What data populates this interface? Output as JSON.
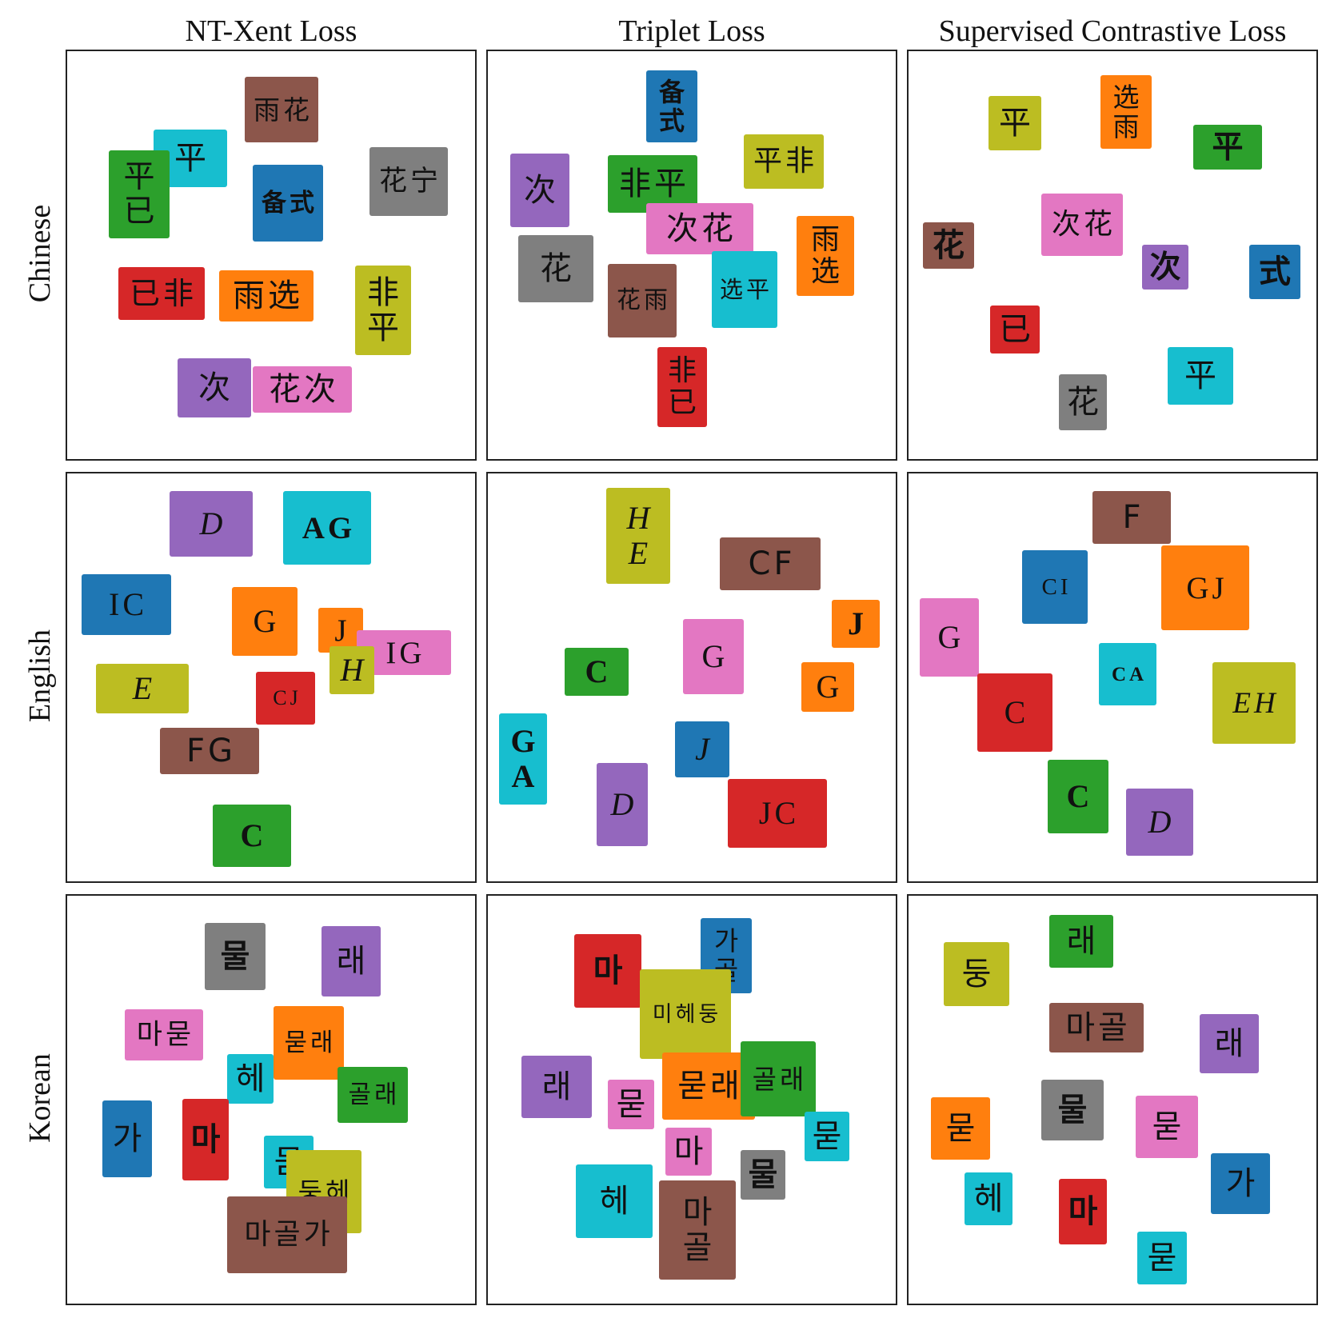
{
  "colors": {
    "blue": "#1f77b4",
    "orange": "#ff7f0e",
    "green": "#2ca02c",
    "red": "#d62728",
    "purple": "#9467bd",
    "brown": "#8c564b",
    "pink": "#e377c2",
    "gray": "#7f7f7f",
    "olive": "#bcbd22",
    "cyan": "#17becf"
  },
  "columns": [
    "NT-Xent Loss",
    "Triplet Loss",
    "Supervised Contrastive Loss"
  ],
  "rows": [
    "Chinese",
    "English",
    "Korean"
  ],
  "panels": [
    [
      {
        "blobs": [
          {
            "c": "brown",
            "g": [
              "雨",
              "花"
            ]
          },
          {
            "c": "cyan",
            "g": [
              "平"
            ]
          },
          {
            "c": "green",
            "g": [
              "平",
              "已"
            ]
          },
          {
            "c": "blue",
            "g": [
              "备",
              "式"
            ],
            "s": "bold"
          },
          {
            "c": "gray",
            "g": [
              "花",
              "宁"
            ]
          },
          {
            "c": "red",
            "g": [
              "已",
              "非"
            ]
          },
          {
            "c": "orange",
            "g": [
              "雨",
              "选"
            ]
          },
          {
            "c": "olive",
            "g": [
              "非",
              "平"
            ]
          },
          {
            "c": "purple",
            "g": [
              "次"
            ]
          },
          {
            "c": "pink",
            "g": [
              "花",
              "次"
            ]
          }
        ]
      },
      {
        "blobs": [
          {
            "c": "blue",
            "g": [
              "备",
              "式"
            ],
            "s": "bold"
          },
          {
            "c": "olive",
            "g": [
              "平",
              "非"
            ]
          },
          {
            "c": "purple",
            "g": [
              "次"
            ]
          },
          {
            "c": "green",
            "g": [
              "非",
              "平"
            ]
          },
          {
            "c": "pink",
            "g": [
              "次",
              "花"
            ]
          },
          {
            "c": "orange",
            "g": [
              "雨",
              "选"
            ]
          },
          {
            "c": "gray",
            "g": [
              "花"
            ]
          },
          {
            "c": "brown",
            "g": [
              "花",
              "雨"
            ]
          },
          {
            "c": "cyan",
            "g": [
              "选",
              "平"
            ]
          },
          {
            "c": "red",
            "g": [
              "非",
              "已"
            ]
          }
        ]
      },
      {
        "blobs": [
          {
            "c": "olive",
            "g": [
              "平"
            ]
          },
          {
            "c": "orange",
            "g": [
              "选",
              "雨"
            ]
          },
          {
            "c": "green",
            "g": [
              "平"
            ],
            "s": "bold"
          },
          {
            "c": "brown",
            "g": [
              "花"
            ],
            "s": "bold"
          },
          {
            "c": "pink",
            "g": [
              "次",
              "花"
            ]
          },
          {
            "c": "purple",
            "g": [
              "次"
            ],
            "s": "bold"
          },
          {
            "c": "blue",
            "g": [
              "式"
            ],
            "s": "bold"
          },
          {
            "c": "red",
            "g": [
              "已"
            ]
          },
          {
            "c": "cyan",
            "g": [
              "平"
            ]
          },
          {
            "c": "gray",
            "g": [
              "花"
            ]
          }
        ]
      }
    ],
    [
      {
        "blobs": [
          {
            "c": "purple",
            "g": [
              "D"
            ],
            "s": "ital"
          },
          {
            "c": "cyan",
            "g": [
              "A",
              "G"
            ],
            "s": "bold"
          },
          {
            "c": "blue",
            "g": [
              "I",
              "C"
            ]
          },
          {
            "c": "orange",
            "g": [
              "G"
            ]
          },
          {
            "c": "orange",
            "g": [
              "J"
            ]
          },
          {
            "c": "pink",
            "g": [
              "I",
              "G"
            ]
          },
          {
            "c": "olive",
            "g": [
              "H"
            ],
            "s": "ital"
          },
          {
            "c": "olive",
            "g": [
              "E"
            ],
            "s": "ital"
          },
          {
            "c": "red",
            "g": [
              "C",
              "J"
            ]
          },
          {
            "c": "brown",
            "g": [
              "F",
              "G"
            ],
            "s": "sans"
          },
          {
            "c": "green",
            "g": [
              "C"
            ],
            "s": "bold"
          }
        ]
      },
      {
        "blobs": [
          {
            "c": "olive",
            "g": [
              "H",
              "E"
            ],
            "s": "ital"
          },
          {
            "c": "brown",
            "g": [
              "C",
              "F"
            ],
            "s": "sans"
          },
          {
            "c": "orange",
            "g": [
              "J"
            ],
            "s": "bold"
          },
          {
            "c": "pink",
            "g": [
              "G"
            ]
          },
          {
            "c": "green",
            "g": [
              "C"
            ],
            "s": "bold"
          },
          {
            "c": "orange",
            "g": [
              "G"
            ]
          },
          {
            "c": "cyan",
            "g": [
              "G",
              "A"
            ],
            "s": "bold"
          },
          {
            "c": "blue",
            "g": [
              "J"
            ],
            "s": "ital"
          },
          {
            "c": "purple",
            "g": [
              "D"
            ],
            "s": "ital"
          },
          {
            "c": "red",
            "g": [
              "J",
              "C"
            ]
          }
        ]
      },
      {
        "blobs": [
          {
            "c": "brown",
            "g": [
              "F"
            ],
            "s": "sans"
          },
          {
            "c": "blue",
            "g": [
              "C",
              "I"
            ]
          },
          {
            "c": "orange",
            "g": [
              "G",
              "J"
            ]
          },
          {
            "c": "pink",
            "g": [
              "G"
            ]
          },
          {
            "c": "cyan",
            "g": [
              "C",
              "A"
            ],
            "s": "bold"
          },
          {
            "c": "red",
            "g": [
              "C"
            ]
          },
          {
            "c": "olive",
            "g": [
              "E",
              "H"
            ],
            "s": "ital"
          },
          {
            "c": "green",
            "g": [
              "C"
            ],
            "s": "bold"
          },
          {
            "c": "purple",
            "g": [
              "D"
            ],
            "s": "ital"
          }
        ]
      }
    ],
    [
      {
        "blobs": [
          {
            "c": "gray",
            "g": [
              "물"
            ],
            "s": "bold"
          },
          {
            "c": "purple",
            "g": [
              "래"
            ]
          },
          {
            "c": "pink",
            "g": [
              "마",
              "묻"
            ]
          },
          {
            "c": "orange",
            "g": [
              "묻",
              "래"
            ]
          },
          {
            "c": "cyan",
            "g": [
              "헤"
            ]
          },
          {
            "c": "green",
            "g": [
              "골",
              "래"
            ]
          },
          {
            "c": "blue",
            "g": [
              "가"
            ]
          },
          {
            "c": "red",
            "g": [
              "마"
            ],
            "s": "bold"
          },
          {
            "c": "cyan",
            "g": [
              "묻"
            ]
          },
          {
            "c": "olive",
            "g": [
              "둥",
              "헤"
            ]
          },
          {
            "c": "brown",
            "g": [
              "마",
              "골",
              "가"
            ]
          }
        ]
      },
      {
        "blobs": [
          {
            "c": "red",
            "g": [
              "마"
            ],
            "s": "bold"
          },
          {
            "c": "blue",
            "g": [
              "가",
              "골"
            ]
          },
          {
            "c": "olive",
            "g": [
              "미",
              "헤",
              "둥"
            ]
          },
          {
            "c": "purple",
            "g": [
              "래"
            ]
          },
          {
            "c": "pink",
            "g": [
              "묻"
            ]
          },
          {
            "c": "orange",
            "g": [
              "묻",
              "래"
            ]
          },
          {
            "c": "green",
            "g": [
              "골",
              "래"
            ]
          },
          {
            "c": "cyan",
            "g": [
              "묻"
            ]
          },
          {
            "c": "pink",
            "g": [
              "마"
            ]
          },
          {
            "c": "gray",
            "g": [
              "물"
            ],
            "s": "bold"
          },
          {
            "c": "cyan",
            "g": [
              "헤"
            ]
          },
          {
            "c": "brown",
            "g": [
              "마",
              "골"
            ]
          }
        ]
      },
      {
        "blobs": [
          {
            "c": "olive",
            "g": [
              "둥"
            ]
          },
          {
            "c": "green",
            "g": [
              "래"
            ]
          },
          {
            "c": "brown",
            "g": [
              "마",
              "골"
            ]
          },
          {
            "c": "purple",
            "g": [
              "래"
            ]
          },
          {
            "c": "orange",
            "g": [
              "묻"
            ]
          },
          {
            "c": "gray",
            "g": [
              "물"
            ],
            "s": "bold"
          },
          {
            "c": "pink",
            "g": [
              "묻"
            ]
          },
          {
            "c": "blue",
            "g": [
              "가"
            ]
          },
          {
            "c": "cyan",
            "g": [
              "헤"
            ]
          },
          {
            "c": "red",
            "g": [
              "마"
            ],
            "s": "bold"
          },
          {
            "c": "cyan",
            "g": [
              "묻"
            ]
          }
        ]
      }
    ]
  ]
}
